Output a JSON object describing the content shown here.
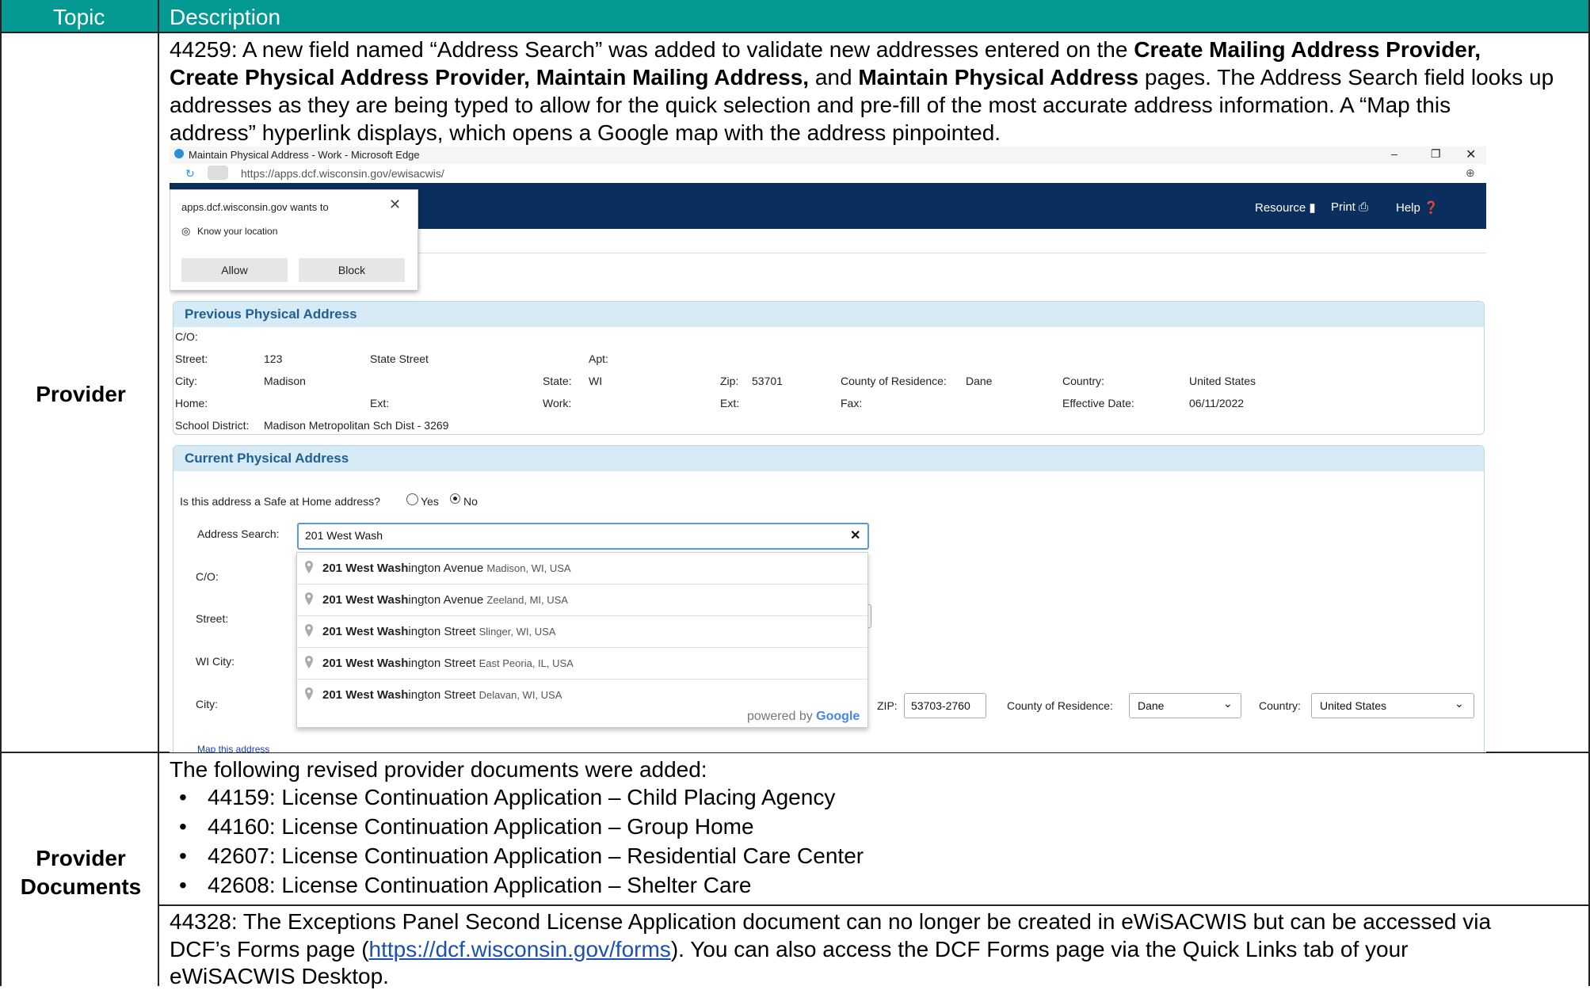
{
  "header": {
    "topic": "Topic",
    "description": "Description"
  },
  "rows": {
    "provider": {
      "topic": "Provider",
      "lines": [
        [
          "44259: A new field named “Address Search” was added to validate new addresses entered on the ",
          "Create Mailing Address Provider,"
        ],
        [
          "Create Physical Address Provider, Maintain Mailing Address,",
          " and ",
          "Maintain Physical Address",
          " pages. The Address Search field looks up"
        ],
        [
          "addresses as they are being typed to allow for the quick selection and pre-fill of the most accurate address information. A “Map this"
        ],
        [
          "address” hyperlink displays, which opens a Google map with the address pinpointed."
        ]
      ]
    },
    "docs": {
      "topic_line1": "Provider",
      "topic_line2": "Documents",
      "intro": "The following revised provider documents were added:",
      "items": [
        "44159: License Continuation Application – Child Placing Agency",
        "44160: License Continuation Application – Group Home",
        "42607: License Continuation Application – Residential Care Center",
        "42608: License Continuation Application – Shelter Care"
      ],
      "para_part1": "44328: The Exceptions Panel Second License Application document can no longer be created in eWiSACWIS but can be accessed via",
      "para_part2a": "DCF’s Forms page (",
      "para_link": "https://dcf.wisconsin.gov/forms",
      "para_part2b": "). You can also access the DCF Forms page via the Quick Links tab of your",
      "para_part3": "eWiSACWIS Desktop."
    }
  },
  "screenshot": {
    "window_title": "Maintain Physical Address - Work - Microsoft Edge",
    "url": "https://apps.dcf.wisconsin.gov/ewisacwis/",
    "nav": {
      "resource": "Resource",
      "print": "Print",
      "help": "Help"
    },
    "location_popup": {
      "title": "apps.dcf.wisconsin.gov wants to",
      "item": "Know your location",
      "allow": "Allow",
      "block": "Block"
    },
    "previous": {
      "title": "Previous Physical Address",
      "co_label": "C/O:",
      "street_label": "Street:",
      "street_num": "123",
      "street_name": "State Street",
      "apt_label": "Apt:",
      "city_label": "City:",
      "city": "Madison",
      "state_label": "State:",
      "state": "WI",
      "zip_label": "Zip:",
      "zip": "53701",
      "county_label": "County of Residence:",
      "county": "Dane",
      "country_label": "Country:",
      "country": "United States",
      "home_label": "Home:",
      "ext_label": "Ext:",
      "work_label": "Work:",
      "ext2_label": "Ext:",
      "fax_label": "Fax:",
      "eff_label": "Effective Date:",
      "eff": "06/11/2022",
      "school_label": "School District:",
      "school": "Madison Metropolitan Sch Dist - 3269"
    },
    "current": {
      "title": "Current Physical Address",
      "safe_q": "Is this address a Safe at Home address?",
      "yes": "Yes",
      "no": "No",
      "search_label": "Address Search:",
      "search_value": "201 West Wash",
      "co_label": "C/O:",
      "street_label": "Street:",
      "wicity_label": "WI City:",
      "city_label": "City:",
      "zip_label": "ZIP:",
      "zip_value": "53703-2760",
      "county_label": "County of Residence:",
      "county_value": "Dane",
      "country_label": "Country:",
      "country_value": "United States",
      "map_link": "Map this address"
    },
    "suggestions": [
      {
        "bold": "201 West Wash",
        "rest": "ington Avenue",
        "place": "Madison, WI, USA"
      },
      {
        "bold": "201 West Wash",
        "rest": "ington Avenue",
        "place": "Zeeland, MI, USA"
      },
      {
        "bold": "201 West Wash",
        "rest": "ington Street",
        "place": "Slinger, WI, USA"
      },
      {
        "bold": "201 West Wash",
        "rest": "ington Street",
        "place": "East Peoria, IL, USA"
      },
      {
        "bold": "201 West Wash",
        "rest": "ington Street",
        "place": "Delavan, WI, USA"
      }
    ],
    "powered_by": "powered by",
    "google": "Google"
  },
  "colors": {
    "header_bg": "#049a93",
    "nav_bg": "#0a2f5e",
    "panel_header": "#d6ebf6"
  }
}
